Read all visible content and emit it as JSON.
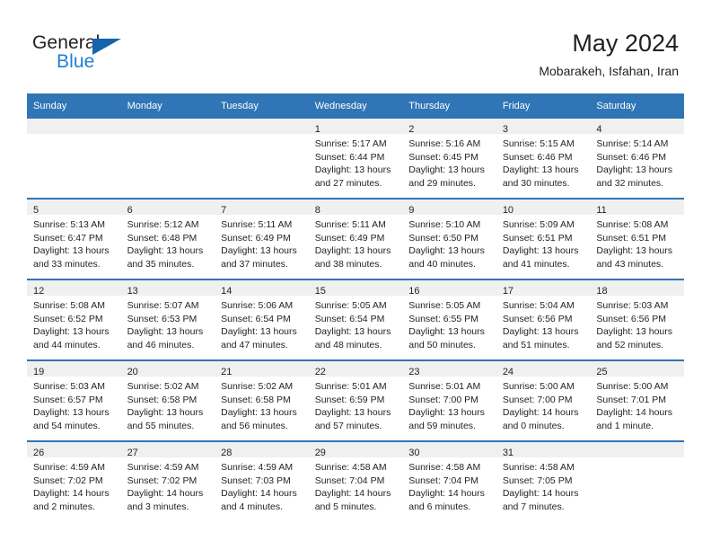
{
  "brand": {
    "name_top": "General",
    "name_bottom": "Blue",
    "triangle_color": "#1464aa",
    "blue_text_color": "#1f7fd4"
  },
  "header": {
    "title": "May 2024",
    "subtitle": "Mobarakeh, Isfahan, Iran",
    "header_bg": "#3075b5",
    "header_text_color": "#ffffff"
  },
  "weekday_headers": [
    "Sunday",
    "Monday",
    "Tuesday",
    "Wednesday",
    "Thursday",
    "Friday",
    "Saturday"
  ],
  "labels": {
    "sunrise_prefix": "Sunrise:",
    "sunset_prefix": "Sunset:",
    "daylight_prefix": "Daylight:"
  },
  "weeks": [
    [
      {
        "day": "",
        "empty": true
      },
      {
        "day": "",
        "empty": true
      },
      {
        "day": "",
        "empty": true
      },
      {
        "day": "1",
        "sunrise": "Sunrise: 5:17 AM",
        "sunset": "Sunset: 6:44 PM",
        "daylight_1": "Daylight: 13 hours",
        "daylight_2": "and 27 minutes."
      },
      {
        "day": "2",
        "sunrise": "Sunrise: 5:16 AM",
        "sunset": "Sunset: 6:45 PM",
        "daylight_1": "Daylight: 13 hours",
        "daylight_2": "and 29 minutes."
      },
      {
        "day": "3",
        "sunrise": "Sunrise: 5:15 AM",
        "sunset": "Sunset: 6:46 PM",
        "daylight_1": "Daylight: 13 hours",
        "daylight_2": "and 30 minutes."
      },
      {
        "day": "4",
        "sunrise": "Sunrise: 5:14 AM",
        "sunset": "Sunset: 6:46 PM",
        "daylight_1": "Daylight: 13 hours",
        "daylight_2": "and 32 minutes."
      }
    ],
    [
      {
        "day": "5",
        "sunrise": "Sunrise: 5:13 AM",
        "sunset": "Sunset: 6:47 PM",
        "daylight_1": "Daylight: 13 hours",
        "daylight_2": "and 33 minutes."
      },
      {
        "day": "6",
        "sunrise": "Sunrise: 5:12 AM",
        "sunset": "Sunset: 6:48 PM",
        "daylight_1": "Daylight: 13 hours",
        "daylight_2": "and 35 minutes."
      },
      {
        "day": "7",
        "sunrise": "Sunrise: 5:11 AM",
        "sunset": "Sunset: 6:49 PM",
        "daylight_1": "Daylight: 13 hours",
        "daylight_2": "and 37 minutes."
      },
      {
        "day": "8",
        "sunrise": "Sunrise: 5:11 AM",
        "sunset": "Sunset: 6:49 PM",
        "daylight_1": "Daylight: 13 hours",
        "daylight_2": "and 38 minutes."
      },
      {
        "day": "9",
        "sunrise": "Sunrise: 5:10 AM",
        "sunset": "Sunset: 6:50 PM",
        "daylight_1": "Daylight: 13 hours",
        "daylight_2": "and 40 minutes."
      },
      {
        "day": "10",
        "sunrise": "Sunrise: 5:09 AM",
        "sunset": "Sunset: 6:51 PM",
        "daylight_1": "Daylight: 13 hours",
        "daylight_2": "and 41 minutes."
      },
      {
        "day": "11",
        "sunrise": "Sunrise: 5:08 AM",
        "sunset": "Sunset: 6:51 PM",
        "daylight_1": "Daylight: 13 hours",
        "daylight_2": "and 43 minutes."
      }
    ],
    [
      {
        "day": "12",
        "sunrise": "Sunrise: 5:08 AM",
        "sunset": "Sunset: 6:52 PM",
        "daylight_1": "Daylight: 13 hours",
        "daylight_2": "and 44 minutes."
      },
      {
        "day": "13",
        "sunrise": "Sunrise: 5:07 AM",
        "sunset": "Sunset: 6:53 PM",
        "daylight_1": "Daylight: 13 hours",
        "daylight_2": "and 46 minutes."
      },
      {
        "day": "14",
        "sunrise": "Sunrise: 5:06 AM",
        "sunset": "Sunset: 6:54 PM",
        "daylight_1": "Daylight: 13 hours",
        "daylight_2": "and 47 minutes."
      },
      {
        "day": "15",
        "sunrise": "Sunrise: 5:05 AM",
        "sunset": "Sunset: 6:54 PM",
        "daylight_1": "Daylight: 13 hours",
        "daylight_2": "and 48 minutes."
      },
      {
        "day": "16",
        "sunrise": "Sunrise: 5:05 AM",
        "sunset": "Sunset: 6:55 PM",
        "daylight_1": "Daylight: 13 hours",
        "daylight_2": "and 50 minutes."
      },
      {
        "day": "17",
        "sunrise": "Sunrise: 5:04 AM",
        "sunset": "Sunset: 6:56 PM",
        "daylight_1": "Daylight: 13 hours",
        "daylight_2": "and 51 minutes."
      },
      {
        "day": "18",
        "sunrise": "Sunrise: 5:03 AM",
        "sunset": "Sunset: 6:56 PM",
        "daylight_1": "Daylight: 13 hours",
        "daylight_2": "and 52 minutes."
      }
    ],
    [
      {
        "day": "19",
        "sunrise": "Sunrise: 5:03 AM",
        "sunset": "Sunset: 6:57 PM",
        "daylight_1": "Daylight: 13 hours",
        "daylight_2": "and 54 minutes."
      },
      {
        "day": "20",
        "sunrise": "Sunrise: 5:02 AM",
        "sunset": "Sunset: 6:58 PM",
        "daylight_1": "Daylight: 13 hours",
        "daylight_2": "and 55 minutes."
      },
      {
        "day": "21",
        "sunrise": "Sunrise: 5:02 AM",
        "sunset": "Sunset: 6:58 PM",
        "daylight_1": "Daylight: 13 hours",
        "daylight_2": "and 56 minutes."
      },
      {
        "day": "22",
        "sunrise": "Sunrise: 5:01 AM",
        "sunset": "Sunset: 6:59 PM",
        "daylight_1": "Daylight: 13 hours",
        "daylight_2": "and 57 minutes."
      },
      {
        "day": "23",
        "sunrise": "Sunrise: 5:01 AM",
        "sunset": "Sunset: 7:00 PM",
        "daylight_1": "Daylight: 13 hours",
        "daylight_2": "and 59 minutes."
      },
      {
        "day": "24",
        "sunrise": "Sunrise: 5:00 AM",
        "sunset": "Sunset: 7:00 PM",
        "daylight_1": "Daylight: 14 hours",
        "daylight_2": "and 0 minutes."
      },
      {
        "day": "25",
        "sunrise": "Sunrise: 5:00 AM",
        "sunset": "Sunset: 7:01 PM",
        "daylight_1": "Daylight: 14 hours",
        "daylight_2": "and 1 minute."
      }
    ],
    [
      {
        "day": "26",
        "sunrise": "Sunrise: 4:59 AM",
        "sunset": "Sunset: 7:02 PM",
        "daylight_1": "Daylight: 14 hours",
        "daylight_2": "and 2 minutes."
      },
      {
        "day": "27",
        "sunrise": "Sunrise: 4:59 AM",
        "sunset": "Sunset: 7:02 PM",
        "daylight_1": "Daylight: 14 hours",
        "daylight_2": "and 3 minutes."
      },
      {
        "day": "28",
        "sunrise": "Sunrise: 4:59 AM",
        "sunset": "Sunset: 7:03 PM",
        "daylight_1": "Daylight: 14 hours",
        "daylight_2": "and 4 minutes."
      },
      {
        "day": "29",
        "sunrise": "Sunrise: 4:58 AM",
        "sunset": "Sunset: 7:04 PM",
        "daylight_1": "Daylight: 14 hours",
        "daylight_2": "and 5 minutes."
      },
      {
        "day": "30",
        "sunrise": "Sunrise: 4:58 AM",
        "sunset": "Sunset: 7:04 PM",
        "daylight_1": "Daylight: 14 hours",
        "daylight_2": "and 6 minutes."
      },
      {
        "day": "31",
        "sunrise": "Sunrise: 4:58 AM",
        "sunset": "Sunset: 7:05 PM",
        "daylight_1": "Daylight: 14 hours",
        "daylight_2": "and 7 minutes."
      },
      {
        "day": "",
        "empty": true
      }
    ]
  ]
}
